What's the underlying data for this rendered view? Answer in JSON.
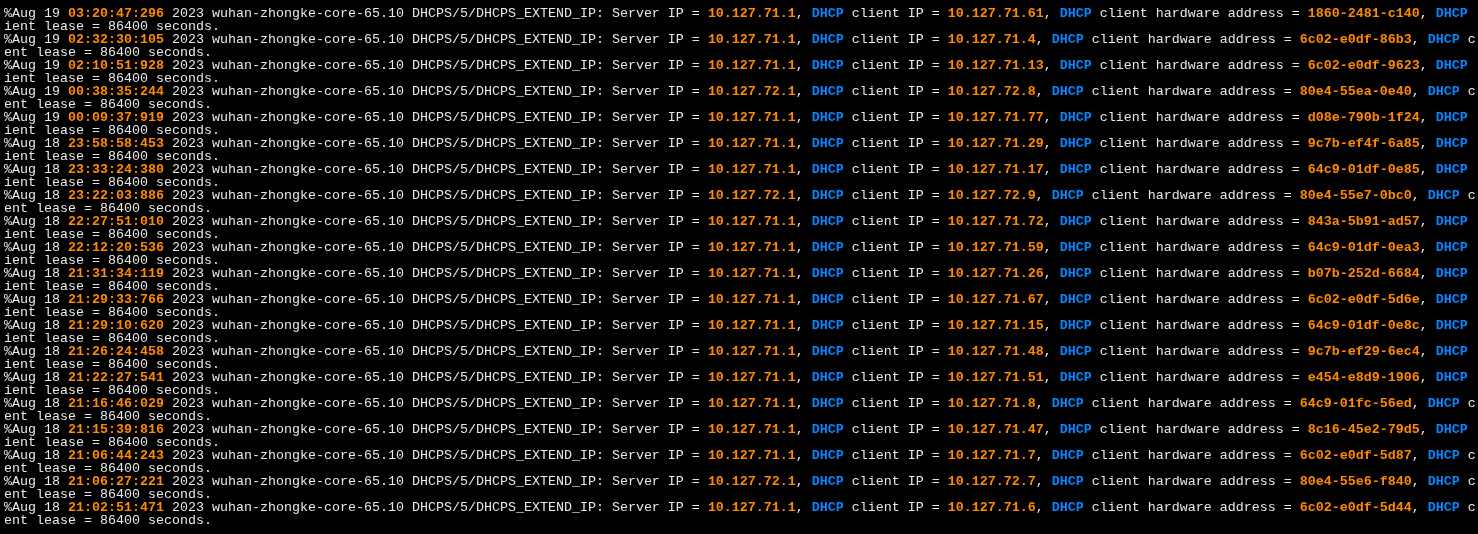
{
  "terminal": {
    "lines": [
      [
        {
          "kind": "plain",
          "text": "%Aug 19 "
        },
        {
          "kind": "value",
          "text": "03:20:47:296"
        },
        {
          "kind": "plain",
          "text": " 2023 wuhan-zhongke-core-65.10 DHCPS/5/DHCPS_EXTEND_IP: Server IP = "
        },
        {
          "kind": "value",
          "text": "10.127.71.1"
        },
        {
          "kind": "plain",
          "text": ", "
        },
        {
          "kind": "keyword",
          "text": "DHCP"
        },
        {
          "kind": "plain",
          "text": " client IP = "
        },
        {
          "kind": "value",
          "text": "10.127.71.61"
        },
        {
          "kind": "plain",
          "text": ", "
        },
        {
          "kind": "keyword",
          "text": "DHCP"
        },
        {
          "kind": "plain",
          "text": " client hardware address = "
        },
        {
          "kind": "value",
          "text": "1860-2481-c140"
        },
        {
          "kind": "plain",
          "text": ", "
        },
        {
          "kind": "keyword",
          "text": "DHCP"
        }
      ],
      [
        {
          "kind": "plain",
          "text": "ient lease = 86400 seconds."
        }
      ],
      [
        {
          "kind": "plain",
          "text": "%Aug 19 "
        },
        {
          "kind": "value",
          "text": "02:32:30:105"
        },
        {
          "kind": "plain",
          "text": " 2023 wuhan-zhongke-core-65.10 DHCPS/5/DHCPS_EXTEND_IP: Server IP = "
        },
        {
          "kind": "value",
          "text": "10.127.71.1"
        },
        {
          "kind": "plain",
          "text": ", "
        },
        {
          "kind": "keyword",
          "text": "DHCP"
        },
        {
          "kind": "plain",
          "text": " client IP = "
        },
        {
          "kind": "value",
          "text": "10.127.71.4"
        },
        {
          "kind": "plain",
          "text": ", "
        },
        {
          "kind": "keyword",
          "text": "DHCP"
        },
        {
          "kind": "plain",
          "text": " client hardware address = "
        },
        {
          "kind": "value",
          "text": "6c02-e0df-86b3"
        },
        {
          "kind": "plain",
          "text": ", "
        },
        {
          "kind": "keyword",
          "text": "DHCP"
        },
        {
          "kind": "plain",
          "text": " c"
        }
      ],
      [
        {
          "kind": "plain",
          "text": "ent lease = 86400 seconds."
        }
      ],
      [
        {
          "kind": "plain",
          "text": "%Aug 19 "
        },
        {
          "kind": "value",
          "text": "02:10:51:928"
        },
        {
          "kind": "plain",
          "text": " 2023 wuhan-zhongke-core-65.10 DHCPS/5/DHCPS_EXTEND_IP: Server IP = "
        },
        {
          "kind": "value",
          "text": "10.127.71.1"
        },
        {
          "kind": "plain",
          "text": ", "
        },
        {
          "kind": "keyword",
          "text": "DHCP"
        },
        {
          "kind": "plain",
          "text": " client IP = "
        },
        {
          "kind": "value",
          "text": "10.127.71.13"
        },
        {
          "kind": "plain",
          "text": ", "
        },
        {
          "kind": "keyword",
          "text": "DHCP"
        },
        {
          "kind": "plain",
          "text": " client hardware address = "
        },
        {
          "kind": "value",
          "text": "6c02-e0df-9623"
        },
        {
          "kind": "plain",
          "text": ", "
        },
        {
          "kind": "keyword",
          "text": "DHCP"
        }
      ],
      [
        {
          "kind": "plain",
          "text": "ient lease = 86400 seconds."
        }
      ],
      [
        {
          "kind": "plain",
          "text": "%Aug 19 "
        },
        {
          "kind": "value",
          "text": "00:38:35:244"
        },
        {
          "kind": "plain",
          "text": " 2023 wuhan-zhongke-core-65.10 DHCPS/5/DHCPS_EXTEND_IP: Server IP = "
        },
        {
          "kind": "value",
          "text": "10.127.72.1"
        },
        {
          "kind": "plain",
          "text": ", "
        },
        {
          "kind": "keyword",
          "text": "DHCP"
        },
        {
          "kind": "plain",
          "text": " client IP = "
        },
        {
          "kind": "value",
          "text": "10.127.72.8"
        },
        {
          "kind": "plain",
          "text": ", "
        },
        {
          "kind": "keyword",
          "text": "DHCP"
        },
        {
          "kind": "plain",
          "text": " client hardware address = "
        },
        {
          "kind": "value",
          "text": "80e4-55ea-0e40"
        },
        {
          "kind": "plain",
          "text": ", "
        },
        {
          "kind": "keyword",
          "text": "DHCP"
        },
        {
          "kind": "plain",
          "text": " c"
        }
      ],
      [
        {
          "kind": "plain",
          "text": "ent lease = 86400 seconds."
        }
      ],
      [
        {
          "kind": "plain",
          "text": "%Aug 19 "
        },
        {
          "kind": "value",
          "text": "00:09:37:919"
        },
        {
          "kind": "plain",
          "text": " 2023 wuhan-zhongke-core-65.10 DHCPS/5/DHCPS_EXTEND_IP: Server IP = "
        },
        {
          "kind": "value",
          "text": "10.127.71.1"
        },
        {
          "kind": "plain",
          "text": ", "
        },
        {
          "kind": "keyword",
          "text": "DHCP"
        },
        {
          "kind": "plain",
          "text": " client IP = "
        },
        {
          "kind": "value",
          "text": "10.127.71.77"
        },
        {
          "kind": "plain",
          "text": ", "
        },
        {
          "kind": "keyword",
          "text": "DHCP"
        },
        {
          "kind": "plain",
          "text": " client hardware address = "
        },
        {
          "kind": "value",
          "text": "d08e-790b-1f24"
        },
        {
          "kind": "plain",
          "text": ", "
        },
        {
          "kind": "keyword",
          "text": "DHCP"
        }
      ],
      [
        {
          "kind": "plain",
          "text": "ient lease = 86400 seconds."
        }
      ],
      [
        {
          "kind": "plain",
          "text": "%Aug 18 "
        },
        {
          "kind": "value",
          "text": "23:58:58:453"
        },
        {
          "kind": "plain",
          "text": " 2023 wuhan-zhongke-core-65.10 DHCPS/5/DHCPS_EXTEND_IP: Server IP = "
        },
        {
          "kind": "value",
          "text": "10.127.71.1"
        },
        {
          "kind": "plain",
          "text": ", "
        },
        {
          "kind": "keyword",
          "text": "DHCP"
        },
        {
          "kind": "plain",
          "text": " client IP = "
        },
        {
          "kind": "value",
          "text": "10.127.71.29"
        },
        {
          "kind": "plain",
          "text": ", "
        },
        {
          "kind": "keyword",
          "text": "DHCP"
        },
        {
          "kind": "plain",
          "text": " client hardware address = "
        },
        {
          "kind": "value",
          "text": "9c7b-ef4f-6a85"
        },
        {
          "kind": "plain",
          "text": ", "
        },
        {
          "kind": "keyword",
          "text": "DHCP"
        }
      ],
      [
        {
          "kind": "plain",
          "text": "ient lease = 86400 seconds."
        }
      ],
      [
        {
          "kind": "plain",
          "text": "%Aug 18 "
        },
        {
          "kind": "value",
          "text": "23:33:24:380"
        },
        {
          "kind": "plain",
          "text": " 2023 wuhan-zhongke-core-65.10 DHCPS/5/DHCPS_EXTEND_IP: Server IP = "
        },
        {
          "kind": "value",
          "text": "10.127.71.1"
        },
        {
          "kind": "plain",
          "text": ", "
        },
        {
          "kind": "keyword",
          "text": "DHCP"
        },
        {
          "kind": "plain",
          "text": " client IP = "
        },
        {
          "kind": "value",
          "text": "10.127.71.17"
        },
        {
          "kind": "plain",
          "text": ", "
        },
        {
          "kind": "keyword",
          "text": "DHCP"
        },
        {
          "kind": "plain",
          "text": " client hardware address = "
        },
        {
          "kind": "value",
          "text": "64c9-01df-0e85"
        },
        {
          "kind": "plain",
          "text": ", "
        },
        {
          "kind": "keyword",
          "text": "DHCP"
        }
      ],
      [
        {
          "kind": "plain",
          "text": "ient lease = 86400 seconds."
        }
      ],
      [
        {
          "kind": "plain",
          "text": "%Aug 18 "
        },
        {
          "kind": "value",
          "text": "23:22:03:886"
        },
        {
          "kind": "plain",
          "text": " 2023 wuhan-zhongke-core-65.10 DHCPS/5/DHCPS_EXTEND_IP: Server IP = "
        },
        {
          "kind": "value",
          "text": "10.127.72.1"
        },
        {
          "kind": "plain",
          "text": ", "
        },
        {
          "kind": "keyword",
          "text": "DHCP"
        },
        {
          "kind": "plain",
          "text": " client IP = "
        },
        {
          "kind": "value",
          "text": "10.127.72.9"
        },
        {
          "kind": "plain",
          "text": ", "
        },
        {
          "kind": "keyword",
          "text": "DHCP"
        },
        {
          "kind": "plain",
          "text": " client hardware address = "
        },
        {
          "kind": "value",
          "text": "80e4-55e7-0bc0"
        },
        {
          "kind": "plain",
          "text": ", "
        },
        {
          "kind": "keyword",
          "text": "DHCP"
        },
        {
          "kind": "plain",
          "text": " c"
        }
      ],
      [
        {
          "kind": "plain",
          "text": "ent lease = 86400 seconds."
        }
      ],
      [
        {
          "kind": "plain",
          "text": "%Aug 18 "
        },
        {
          "kind": "value",
          "text": "22:27:51:010"
        },
        {
          "kind": "plain",
          "text": " 2023 wuhan-zhongke-core-65.10 DHCPS/5/DHCPS_EXTEND_IP: Server IP = "
        },
        {
          "kind": "value",
          "text": "10.127.71.1"
        },
        {
          "kind": "plain",
          "text": ", "
        },
        {
          "kind": "keyword",
          "text": "DHCP"
        },
        {
          "kind": "plain",
          "text": " client IP = "
        },
        {
          "kind": "value",
          "text": "10.127.71.72"
        },
        {
          "kind": "plain",
          "text": ", "
        },
        {
          "kind": "keyword",
          "text": "DHCP"
        },
        {
          "kind": "plain",
          "text": " client hardware address = "
        },
        {
          "kind": "value",
          "text": "843a-5b91-ad57"
        },
        {
          "kind": "plain",
          "text": ", "
        },
        {
          "kind": "keyword",
          "text": "DHCP"
        }
      ],
      [
        {
          "kind": "plain",
          "text": "ient lease = 86400 seconds."
        }
      ],
      [
        {
          "kind": "plain",
          "text": "%Aug 18 "
        },
        {
          "kind": "value",
          "text": "22:12:20:536"
        },
        {
          "kind": "plain",
          "text": " 2023 wuhan-zhongke-core-65.10 DHCPS/5/DHCPS_EXTEND_IP: Server IP = "
        },
        {
          "kind": "value",
          "text": "10.127.71.1"
        },
        {
          "kind": "plain",
          "text": ", "
        },
        {
          "kind": "keyword",
          "text": "DHCP"
        },
        {
          "kind": "plain",
          "text": " client IP = "
        },
        {
          "kind": "value",
          "text": "10.127.71.59"
        },
        {
          "kind": "plain",
          "text": ", "
        },
        {
          "kind": "keyword",
          "text": "DHCP"
        },
        {
          "kind": "plain",
          "text": " client hardware address = "
        },
        {
          "kind": "value",
          "text": "64c9-01df-0ea3"
        },
        {
          "kind": "plain",
          "text": ", "
        },
        {
          "kind": "keyword",
          "text": "DHCP"
        }
      ],
      [
        {
          "kind": "plain",
          "text": "ient lease = 86400 seconds."
        }
      ],
      [
        {
          "kind": "plain",
          "text": "%Aug 18 "
        },
        {
          "kind": "value",
          "text": "21:31:34:119"
        },
        {
          "kind": "plain",
          "text": " 2023 wuhan-zhongke-core-65.10 DHCPS/5/DHCPS_EXTEND_IP: Server IP = "
        },
        {
          "kind": "value",
          "text": "10.127.71.1"
        },
        {
          "kind": "plain",
          "text": ", "
        },
        {
          "kind": "keyword",
          "text": "DHCP"
        },
        {
          "kind": "plain",
          "text": " client IP = "
        },
        {
          "kind": "value",
          "text": "10.127.71.26"
        },
        {
          "kind": "plain",
          "text": ", "
        },
        {
          "kind": "keyword",
          "text": "DHCP"
        },
        {
          "kind": "plain",
          "text": " client hardware address = "
        },
        {
          "kind": "value",
          "text": "b07b-252d-6684"
        },
        {
          "kind": "plain",
          "text": ", "
        },
        {
          "kind": "keyword",
          "text": "DHCP"
        }
      ],
      [
        {
          "kind": "plain",
          "text": "ient lease = 86400 seconds."
        }
      ],
      [
        {
          "kind": "plain",
          "text": "%Aug 18 "
        },
        {
          "kind": "value",
          "text": "21:29:33:766"
        },
        {
          "kind": "plain",
          "text": " 2023 wuhan-zhongke-core-65.10 DHCPS/5/DHCPS_EXTEND_IP: Server IP = "
        },
        {
          "kind": "value",
          "text": "10.127.71.1"
        },
        {
          "kind": "plain",
          "text": ", "
        },
        {
          "kind": "keyword",
          "text": "DHCP"
        },
        {
          "kind": "plain",
          "text": " client IP = "
        },
        {
          "kind": "value",
          "text": "10.127.71.67"
        },
        {
          "kind": "plain",
          "text": ", "
        },
        {
          "kind": "keyword",
          "text": "DHCP"
        },
        {
          "kind": "plain",
          "text": " client hardware address = "
        },
        {
          "kind": "value",
          "text": "6c02-e0df-5d6e"
        },
        {
          "kind": "plain",
          "text": ", "
        },
        {
          "kind": "keyword",
          "text": "DHCP"
        }
      ],
      [
        {
          "kind": "plain",
          "text": "ient lease = 86400 seconds."
        }
      ],
      [
        {
          "kind": "plain",
          "text": "%Aug 18 "
        },
        {
          "kind": "value",
          "text": "21:29:10:620"
        },
        {
          "kind": "plain",
          "text": " 2023 wuhan-zhongke-core-65.10 DHCPS/5/DHCPS_EXTEND_IP: Server IP = "
        },
        {
          "kind": "value",
          "text": "10.127.71.1"
        },
        {
          "kind": "plain",
          "text": ", "
        },
        {
          "kind": "keyword",
          "text": "DHCP"
        },
        {
          "kind": "plain",
          "text": " client IP = "
        },
        {
          "kind": "value",
          "text": "10.127.71.15"
        },
        {
          "kind": "plain",
          "text": ", "
        },
        {
          "kind": "keyword",
          "text": "DHCP"
        },
        {
          "kind": "plain",
          "text": " client hardware address = "
        },
        {
          "kind": "value",
          "text": "64c9-01df-0e8c"
        },
        {
          "kind": "plain",
          "text": ", "
        },
        {
          "kind": "keyword",
          "text": "DHCP"
        }
      ],
      [
        {
          "kind": "plain",
          "text": "ient lease = 86400 seconds."
        }
      ],
      [
        {
          "kind": "plain",
          "text": "%Aug 18 "
        },
        {
          "kind": "value",
          "text": "21:26:24:458"
        },
        {
          "kind": "plain",
          "text": " 2023 wuhan-zhongke-core-65.10 DHCPS/5/DHCPS_EXTEND_IP: Server IP = "
        },
        {
          "kind": "value",
          "text": "10.127.71.1"
        },
        {
          "kind": "plain",
          "text": ", "
        },
        {
          "kind": "keyword",
          "text": "DHCP"
        },
        {
          "kind": "plain",
          "text": " client IP = "
        },
        {
          "kind": "value",
          "text": "10.127.71.48"
        },
        {
          "kind": "plain",
          "text": ", "
        },
        {
          "kind": "keyword",
          "text": "DHCP"
        },
        {
          "kind": "plain",
          "text": " client hardware address = "
        },
        {
          "kind": "value",
          "text": "9c7b-ef29-6ec4"
        },
        {
          "kind": "plain",
          "text": ", "
        },
        {
          "kind": "keyword",
          "text": "DHCP"
        }
      ],
      [
        {
          "kind": "plain",
          "text": "ient lease = 86400 seconds."
        }
      ],
      [
        {
          "kind": "plain",
          "text": "%Aug 18 "
        },
        {
          "kind": "value",
          "text": "21:22:27:541"
        },
        {
          "kind": "plain",
          "text": " 2023 wuhan-zhongke-core-65.10 DHCPS/5/DHCPS_EXTEND_IP: Server IP = "
        },
        {
          "kind": "value",
          "text": "10.127.71.1"
        },
        {
          "kind": "plain",
          "text": ", "
        },
        {
          "kind": "keyword",
          "text": "DHCP"
        },
        {
          "kind": "plain",
          "text": " client IP = "
        },
        {
          "kind": "value",
          "text": "10.127.71.51"
        },
        {
          "kind": "plain",
          "text": ", "
        },
        {
          "kind": "keyword",
          "text": "DHCP"
        },
        {
          "kind": "plain",
          "text": " client hardware address = "
        },
        {
          "kind": "value",
          "text": "e454-e8d9-1906"
        },
        {
          "kind": "plain",
          "text": ", "
        },
        {
          "kind": "keyword",
          "text": "DHCP"
        }
      ],
      [
        {
          "kind": "plain",
          "text": "ient lease = 86400 seconds."
        }
      ],
      [
        {
          "kind": "plain",
          "text": "%Aug 18 "
        },
        {
          "kind": "value",
          "text": "21:16:46:029"
        },
        {
          "kind": "plain",
          "text": " 2023 wuhan-zhongke-core-65.10 DHCPS/5/DHCPS_EXTEND_IP: Server IP = "
        },
        {
          "kind": "value",
          "text": "10.127.71.1"
        },
        {
          "kind": "plain",
          "text": ", "
        },
        {
          "kind": "keyword",
          "text": "DHCP"
        },
        {
          "kind": "plain",
          "text": " client IP = "
        },
        {
          "kind": "value",
          "text": "10.127.71.8"
        },
        {
          "kind": "plain",
          "text": ", "
        },
        {
          "kind": "keyword",
          "text": "DHCP"
        },
        {
          "kind": "plain",
          "text": " client hardware address = "
        },
        {
          "kind": "value",
          "text": "64c9-01fc-56ed"
        },
        {
          "kind": "plain",
          "text": ", "
        },
        {
          "kind": "keyword",
          "text": "DHCP"
        },
        {
          "kind": "plain",
          "text": " c"
        }
      ],
      [
        {
          "kind": "plain",
          "text": "ent lease = 86400 seconds."
        }
      ],
      [
        {
          "kind": "plain",
          "text": "%Aug 18 "
        },
        {
          "kind": "value",
          "text": "21:15:39:816"
        },
        {
          "kind": "plain",
          "text": " 2023 wuhan-zhongke-core-65.10 DHCPS/5/DHCPS_EXTEND_IP: Server IP = "
        },
        {
          "kind": "value",
          "text": "10.127.71.1"
        },
        {
          "kind": "plain",
          "text": ", "
        },
        {
          "kind": "keyword",
          "text": "DHCP"
        },
        {
          "kind": "plain",
          "text": " client IP = "
        },
        {
          "kind": "value",
          "text": "10.127.71.47"
        },
        {
          "kind": "plain",
          "text": ", "
        },
        {
          "kind": "keyword",
          "text": "DHCP"
        },
        {
          "kind": "plain",
          "text": " client hardware address = "
        },
        {
          "kind": "value",
          "text": "8c16-45e2-79d5"
        },
        {
          "kind": "plain",
          "text": ", "
        },
        {
          "kind": "keyword",
          "text": "DHCP"
        }
      ],
      [
        {
          "kind": "plain",
          "text": "ient lease = 86400 seconds."
        }
      ],
      [
        {
          "kind": "plain",
          "text": "%Aug 18 "
        },
        {
          "kind": "value",
          "text": "21:06:44:243"
        },
        {
          "kind": "plain",
          "text": " 2023 wuhan-zhongke-core-65.10 DHCPS/5/DHCPS_EXTEND_IP: Server IP = "
        },
        {
          "kind": "value",
          "text": "10.127.71.1"
        },
        {
          "kind": "plain",
          "text": ", "
        },
        {
          "kind": "keyword",
          "text": "DHCP"
        },
        {
          "kind": "plain",
          "text": " client IP = "
        },
        {
          "kind": "value",
          "text": "10.127.71.7"
        },
        {
          "kind": "plain",
          "text": ", "
        },
        {
          "kind": "keyword",
          "text": "DHCP"
        },
        {
          "kind": "plain",
          "text": " client hardware address = "
        },
        {
          "kind": "value",
          "text": "6c02-e0df-5d87"
        },
        {
          "kind": "plain",
          "text": ", "
        },
        {
          "kind": "keyword",
          "text": "DHCP"
        },
        {
          "kind": "plain",
          "text": " c"
        }
      ],
      [
        {
          "kind": "plain",
          "text": "ent lease = 86400 seconds."
        }
      ],
      [
        {
          "kind": "plain",
          "text": "%Aug 18 "
        },
        {
          "kind": "value",
          "text": "21:06:27:221"
        },
        {
          "kind": "plain",
          "text": " 2023 wuhan-zhongke-core-65.10 DHCPS/5/DHCPS_EXTEND_IP: Server IP = "
        },
        {
          "kind": "value",
          "text": "10.127.72.1"
        },
        {
          "kind": "plain",
          "text": ", "
        },
        {
          "kind": "keyword",
          "text": "DHCP"
        },
        {
          "kind": "plain",
          "text": " client IP = "
        },
        {
          "kind": "value",
          "text": "10.127.72.7"
        },
        {
          "kind": "plain",
          "text": ", "
        },
        {
          "kind": "keyword",
          "text": "DHCP"
        },
        {
          "kind": "plain",
          "text": " client hardware address = "
        },
        {
          "kind": "value",
          "text": "80e4-55e6-f840"
        },
        {
          "kind": "plain",
          "text": ", "
        },
        {
          "kind": "keyword",
          "text": "DHCP"
        },
        {
          "kind": "plain",
          "text": " c"
        }
      ],
      [
        {
          "kind": "plain",
          "text": "ent lease = 86400 seconds."
        }
      ],
      [
        {
          "kind": "plain",
          "text": "%Aug 18 "
        },
        {
          "kind": "value",
          "text": "21:02:51:471"
        },
        {
          "kind": "plain",
          "text": " 2023 wuhan-zhongke-core-65.10 DHCPS/5/DHCPS_EXTEND_IP: Server IP = "
        },
        {
          "kind": "value",
          "text": "10.127.71.1"
        },
        {
          "kind": "plain",
          "text": ", "
        },
        {
          "kind": "keyword",
          "text": "DHCP"
        },
        {
          "kind": "plain",
          "text": " client IP = "
        },
        {
          "kind": "value",
          "text": "10.127.71.6"
        },
        {
          "kind": "plain",
          "text": ", "
        },
        {
          "kind": "keyword",
          "text": "DHCP"
        },
        {
          "kind": "plain",
          "text": " client hardware address = "
        },
        {
          "kind": "value",
          "text": "6c02-e0df-5d44"
        },
        {
          "kind": "plain",
          "text": ", "
        },
        {
          "kind": "keyword",
          "text": "DHCP"
        },
        {
          "kind": "plain",
          "text": " c"
        }
      ],
      [
        {
          "kind": "plain",
          "text": "ent lease = 86400 seconds."
        }
      ]
    ]
  }
}
